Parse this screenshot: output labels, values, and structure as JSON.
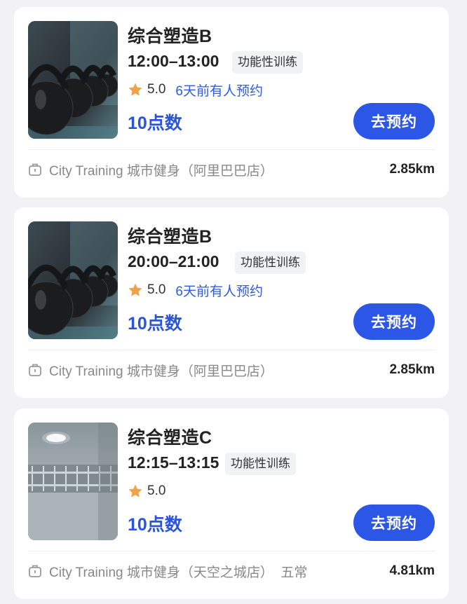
{
  "classes": [
    {
      "title": "综合塑造B",
      "time": "12:00–13:00",
      "tag": "功能性训练",
      "rating": "5.0",
      "recent": "6天前有人预约",
      "points": "10点数",
      "button": "去预约",
      "store": "City Training 城市健身（阿里巴巴店）",
      "distance": "2.85km",
      "image": "kettlebells"
    },
    {
      "title": "综合塑造B",
      "time": "20:00–21:00",
      "tag": "功能性训练",
      "rating": "5.0",
      "recent": "6天前有人预约",
      "points": "10点数",
      "button": "去预约",
      "store": "City Training 城市健身（阿里巴巴店）",
      "distance": "2.85km",
      "image": "kettlebells"
    },
    {
      "title": "综合塑造C",
      "time": "12:15–13:15",
      "tag": "功能性训练",
      "rating": "5.0",
      "recent": "",
      "points": "10点数",
      "button": "去预约",
      "store": "City Training 城市健身（天空之城店）  五常",
      "distance": "4.81km",
      "image": "gym-room"
    }
  ],
  "colors": {
    "accent": "#2c57e6",
    "points": "#2b55d8",
    "star": "#f0a24b",
    "recent_text": "#2f5bdf"
  },
  "icons": {
    "rating": "star-icon",
    "store": "store-icon",
    "photo_1": "kettlebell-photo",
    "photo_3": "gym-room-photo"
  }
}
